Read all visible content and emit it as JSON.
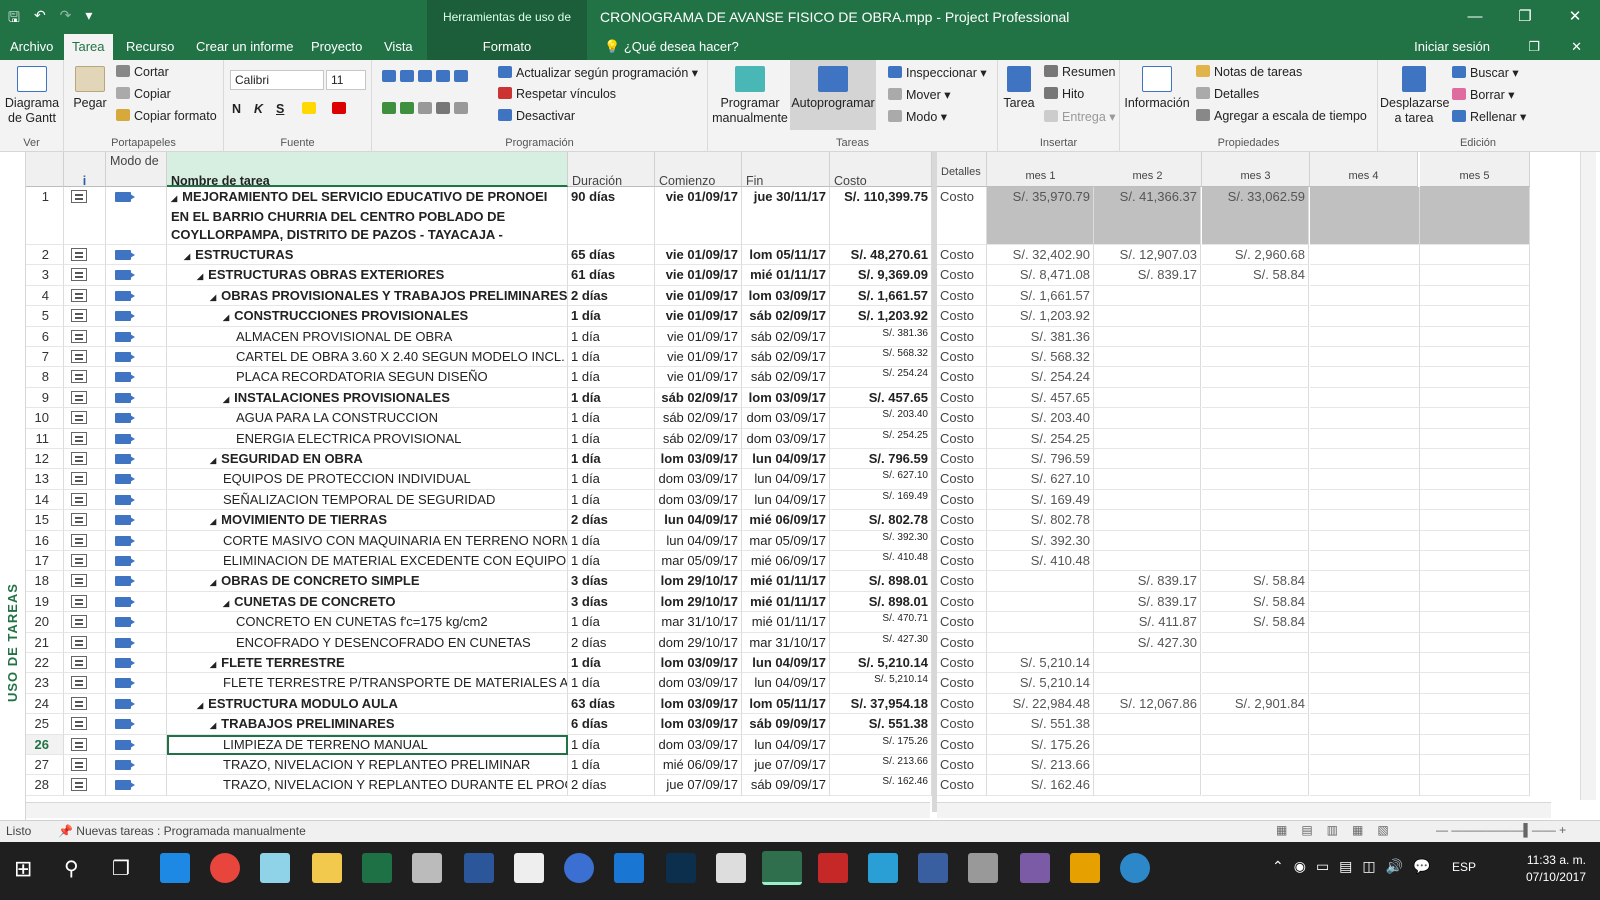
{
  "window": {
    "title": "CRONOGRAMA DE AVANSE FISICO DE OBRA.mpp - Project Professional",
    "context_group": "Herramientas de uso de tareas",
    "minimize": "—",
    "restore": "❐",
    "close": "✕"
  },
  "tabs": {
    "archivo": "Archivo",
    "tarea": "Tarea",
    "recurso": "Recurso",
    "informe": "Crear un informe",
    "proyecto": "Proyecto",
    "vista": "Vista",
    "formato": "Formato",
    "tellme": "¿Qué desea hacer?",
    "signin": "Iniciar sesión"
  },
  "ribbon": {
    "ver": {
      "gantt": "Diagrama de Gantt",
      "label": "Ver"
    },
    "portapapeles": {
      "pegar": "Pegar",
      "cortar": "Cortar",
      "copiar": "Copiar",
      "copiar_formato": "Copiar formato",
      "label": "Portapapeles"
    },
    "fuente": {
      "font": "Calibri",
      "size": "11",
      "bold": "N",
      "italic": "K",
      "underline": "S",
      "label": "Fuente"
    },
    "programacion": {
      "actualizar": "Actualizar según programación",
      "respetar": "Respetar vínculos",
      "desactivar": "Desactivar",
      "label": "Programación"
    },
    "tareas": {
      "manual": "Programar manualmente",
      "auto": "Autoprogramar",
      "inspeccionar": "Inspeccionar",
      "mover": "Mover",
      "modo": "Modo",
      "label": "Tareas"
    },
    "insertar": {
      "tarea": "Tarea",
      "resumen": "Resumen",
      "hito": "Hito",
      "entrega": "Entrega",
      "label": "Insertar"
    },
    "propiedades": {
      "informacion": "Información",
      "notas": "Notas de tareas",
      "detalles": "Detalles",
      "escala": "Agregar a escala de tiempo",
      "label": "Propiedades"
    },
    "edicion": {
      "desplazarse": "Desplazarse a tarea",
      "buscar": "Buscar",
      "borrar": "Borrar",
      "rellenar": "Rellenar",
      "label": "Edición"
    }
  },
  "view_label": "USO DE TAREAS",
  "columns": {
    "info": "i",
    "modo": "Modo de",
    "nombre": "Nombre de tarea",
    "duracion": "Duración",
    "comienzo": "Comienzo",
    "fin": "Fin",
    "costo": "Costo",
    "detalles": "Detalles",
    "months": [
      "mes 1",
      "mes 2",
      "mes 3",
      "mes 4",
      "mes 5"
    ]
  },
  "rows": [
    {
      "id": "1",
      "name": "MEJORAMIENTO DEL SERVICIO EDUCATIVO DE PRONOEI EN EL BARRIO CHURRIA DEL CENTRO POBLADO DE COYLLORPAMPA, DISTRITO DE PAZOS - TAYACAJA - HUANCAVELICA",
      "dur": "90 días",
      "start": "vie 01/09/17",
      "end": "jue 30/11/17",
      "cost": "S/. 110,399.75",
      "det": "Costo",
      "m1": "S/. 35,970.79",
      "m2": "S/. 41,366.37",
      "m3": "S/. 33,062.59",
      "level": 0,
      "bold": true
    },
    {
      "id": "2",
      "name": "ESTRUCTURAS",
      "dur": "65 días",
      "start": "vie 01/09/17",
      "end": "lom 05/11/17",
      "cost": "S/. 48,270.61",
      "det": "Costo",
      "m1": "S/. 32,402.90",
      "m2": "S/. 12,907.03",
      "m3": "S/. 2,960.68",
      "level": 1,
      "bold": true
    },
    {
      "id": "3",
      "name": "ESTRUCTURAS OBRAS EXTERIORES",
      "dur": "61 días",
      "start": "vie 01/09/17",
      "end": "mié 01/11/17",
      "cost": "S/. 9,369.09",
      "det": "Costo",
      "m1": "S/. 8,471.08",
      "m2": "S/. 839.17",
      "m3": "S/. 58.84",
      "level": 2,
      "bold": true
    },
    {
      "id": "4",
      "name": "OBRAS PROVISIONALES Y TRABAJOS PRELIMINARES",
      "dur": "2 días",
      "start": "vie 01/09/17",
      "end": "lom 03/09/17",
      "cost": "S/. 1,661.57",
      "det": "Costo",
      "m1": "S/. 1,661.57",
      "m2": "",
      "m3": "",
      "level": 3,
      "bold": true
    },
    {
      "id": "5",
      "name": "CONSTRUCCIONES PROVISIONALES",
      "dur": "1 día",
      "start": "vie 01/09/17",
      "end": "sáb 02/09/17",
      "cost": "S/. 1,203.92",
      "det": "Costo",
      "m1": "S/. 1,203.92",
      "m2": "",
      "m3": "",
      "level": 4,
      "bold": true
    },
    {
      "id": "6",
      "name": "ALMACEN PROVISIONAL DE OBRA",
      "dur": "1 día",
      "start": "vie 01/09/17",
      "end": "sáb 02/09/17",
      "cost": "S/. 381.36",
      "det": "Costo",
      "m1": "S/. 381.36",
      "m2": "",
      "m3": "",
      "level": 5,
      "bold": false
    },
    {
      "id": "7",
      "name": "CARTEL DE OBRA 3.60 X 2.40 SEGUN MODELO INCL.",
      "dur": "1 día",
      "start": "vie 01/09/17",
      "end": "sáb 02/09/17",
      "cost": "S/. 568.32",
      "det": "Costo",
      "m1": "S/. 568.32",
      "m2": "",
      "m3": "",
      "level": 5,
      "bold": false
    },
    {
      "id": "8",
      "name": "PLACA RECORDATORIA SEGUN DISEÑO",
      "dur": "1 día",
      "start": "vie 01/09/17",
      "end": "sáb 02/09/17",
      "cost": "S/. 254.24",
      "det": "Costo",
      "m1": "S/. 254.24",
      "m2": "",
      "m3": "",
      "level": 5,
      "bold": false
    },
    {
      "id": "9",
      "name": "INSTALACIONES PROVISIONALES",
      "dur": "1 día",
      "start": "sáb 02/09/17",
      "end": "lom 03/09/17",
      "cost": "S/. 457.65",
      "det": "Costo",
      "m1": "S/. 457.65",
      "m2": "",
      "m3": "",
      "level": 4,
      "bold": true
    },
    {
      "id": "10",
      "name": "AGUA PARA LA CONSTRUCCION",
      "dur": "1 día",
      "start": "sáb 02/09/17",
      "end": "dom 03/09/17",
      "cost": "S/. 203.40",
      "det": "Costo",
      "m1": "S/. 203.40",
      "m2": "",
      "m3": "",
      "level": 5,
      "bold": false
    },
    {
      "id": "11",
      "name": "ENERGIA ELECTRICA PROVISIONAL",
      "dur": "1 día",
      "start": "sáb 02/09/17",
      "end": "dom 03/09/17",
      "cost": "S/. 254.25",
      "det": "Costo",
      "m1": "S/. 254.25",
      "m2": "",
      "m3": "",
      "level": 5,
      "bold": false
    },
    {
      "id": "12",
      "name": "SEGURIDAD EN OBRA",
      "dur": "1 día",
      "start": "lom 03/09/17",
      "end": "lun 04/09/17",
      "cost": "S/. 796.59",
      "det": "Costo",
      "m1": "S/. 796.59",
      "m2": "",
      "m3": "",
      "level": 3,
      "bold": true
    },
    {
      "id": "13",
      "name": "EQUIPOS DE PROTECCION INDIVIDUAL",
      "dur": "1 día",
      "start": "dom 03/09/17",
      "end": "lun 04/09/17",
      "cost": "S/. 627.10",
      "det": "Costo",
      "m1": "S/. 627.10",
      "m2": "",
      "m3": "",
      "level": 4,
      "bold": false
    },
    {
      "id": "14",
      "name": "SEÑALIZACION TEMPORAL DE SEGURIDAD",
      "dur": "1 día",
      "start": "dom 03/09/17",
      "end": "lun 04/09/17",
      "cost": "S/. 169.49",
      "det": "Costo",
      "m1": "S/. 169.49",
      "m2": "",
      "m3": "",
      "level": 4,
      "bold": false
    },
    {
      "id": "15",
      "name": "MOVIMIENTO DE TIERRAS",
      "dur": "2 días",
      "start": "lun 04/09/17",
      "end": "mié 06/09/17",
      "cost": "S/. 802.78",
      "det": "Costo",
      "m1": "S/. 802.78",
      "m2": "",
      "m3": "",
      "level": 3,
      "bold": true
    },
    {
      "id": "16",
      "name": "CORTE MASIVO CON MAQUINARIA EN TERRENO NORM",
      "dur": "1 día",
      "start": "lun 04/09/17",
      "end": "mar 05/09/17",
      "cost": "S/. 392.30",
      "det": "Costo",
      "m1": "S/. 392.30",
      "m2": "",
      "m3": "",
      "level": 4,
      "bold": false
    },
    {
      "id": "17",
      "name": "ELIMINACION DE MATERIAL EXCEDENTE CON EQUIPO",
      "dur": "1 día",
      "start": "mar 05/09/17",
      "end": "mié 06/09/17",
      "cost": "S/. 410.48",
      "det": "Costo",
      "m1": "S/. 410.48",
      "m2": "",
      "m3": "",
      "level": 4,
      "bold": false
    },
    {
      "id": "18",
      "name": "OBRAS DE CONCRETO SIMPLE",
      "dur": "3 días",
      "start": "lom 29/10/17",
      "end": "mié 01/11/17",
      "cost": "S/. 898.01",
      "det": "Costo",
      "m1": "",
      "m2": "S/. 839.17",
      "m3": "S/. 58.84",
      "level": 3,
      "bold": true
    },
    {
      "id": "19",
      "name": "CUNETAS DE CONCRETO",
      "dur": "3 días",
      "start": "lom 29/10/17",
      "end": "mié 01/11/17",
      "cost": "S/. 898.01",
      "det": "Costo",
      "m1": "",
      "m2": "S/. 839.17",
      "m3": "S/. 58.84",
      "level": 4,
      "bold": true
    },
    {
      "id": "20",
      "name": "CONCRETO EN CUNETAS f'c=175 kg/cm2",
      "dur": "1 día",
      "start": "mar 31/10/17",
      "end": "mié 01/11/17",
      "cost": "S/. 470.71",
      "det": "Costo",
      "m1": "",
      "m2": "S/. 411.87",
      "m3": "S/. 58.84",
      "level": 5,
      "bold": false
    },
    {
      "id": "21",
      "name": "ENCOFRADO Y DESENCOFRADO EN CUNETAS",
      "dur": "2 días",
      "start": "dom 29/10/17",
      "end": "mar 31/10/17",
      "cost": "S/. 427.30",
      "det": "Costo",
      "m1": "",
      "m2": "S/. 427.30",
      "m3": "",
      "level": 5,
      "bold": false
    },
    {
      "id": "22",
      "name": "FLETE TERRESTRE",
      "dur": "1 día",
      "start": "lom 03/09/17",
      "end": "lun 04/09/17",
      "cost": "S/. 5,210.14",
      "det": "Costo",
      "m1": "S/. 5,210.14",
      "m2": "",
      "m3": "",
      "level": 3,
      "bold": true
    },
    {
      "id": "23",
      "name": "FLETE TERRESTRE P/TRANSPORTE DE MATERIALES A AL",
      "dur": "1 día",
      "start": "dom 03/09/17",
      "end": "lun 04/09/17",
      "cost": "S/. 5,210.14",
      "det": "Costo",
      "m1": "S/. 5,210.14",
      "m2": "",
      "m3": "",
      "level": 4,
      "bold": false
    },
    {
      "id": "24",
      "name": "ESTRUCTURA MODULO AULA",
      "dur": "63 días",
      "start": "lom 03/09/17",
      "end": "lom 05/11/17",
      "cost": "S/. 37,954.18",
      "det": "Costo",
      "m1": "S/. 22,984.48",
      "m2": "S/. 12,067.86",
      "m3": "S/. 2,901.84",
      "level": 2,
      "bold": true
    },
    {
      "id": "25",
      "name": "TRABAJOS PRELIMINARES",
      "dur": "6 días",
      "start": "lom 03/09/17",
      "end": "sáb 09/09/17",
      "cost": "S/. 551.38",
      "det": "Costo",
      "m1": "S/. 551.38",
      "m2": "",
      "m3": "",
      "level": 3,
      "bold": true
    },
    {
      "id": "26",
      "name": "LIMPIEZA DE TERRENO MANUAL",
      "dur": "1 día",
      "start": "dom 03/09/17",
      "end": "lun 04/09/17",
      "cost": "S/. 175.26",
      "det": "Costo",
      "m1": "S/. 175.26",
      "m2": "",
      "m3": "",
      "level": 4,
      "bold": false
    },
    {
      "id": "27",
      "name": "TRAZO, NIVELACION Y REPLANTEO PRELIMINAR",
      "dur": "1 día",
      "start": "mié 06/09/17",
      "end": "jue 07/09/17",
      "cost": "S/. 213.66",
      "det": "Costo",
      "m1": "S/. 213.66",
      "m2": "",
      "m3": "",
      "level": 4,
      "bold": false
    },
    {
      "id": "28",
      "name": "TRAZO, NIVELACION Y REPLANTEO DURANTE EL PROCESO",
      "dur": "2 días",
      "start": "jue 07/09/17",
      "end": "sáb 09/09/17",
      "cost": "S/. 162.46",
      "det": "Costo",
      "m1": "S/. 162.46",
      "m2": "",
      "m3": "",
      "level": 4,
      "bold": false
    }
  ],
  "status": {
    "listo": "Listo",
    "nuevas": "Nuevas tareas : Programada manualmente"
  },
  "clock": {
    "time": "11:33 a. m.",
    "date": "07/10/2017",
    "lang": "ESP"
  }
}
